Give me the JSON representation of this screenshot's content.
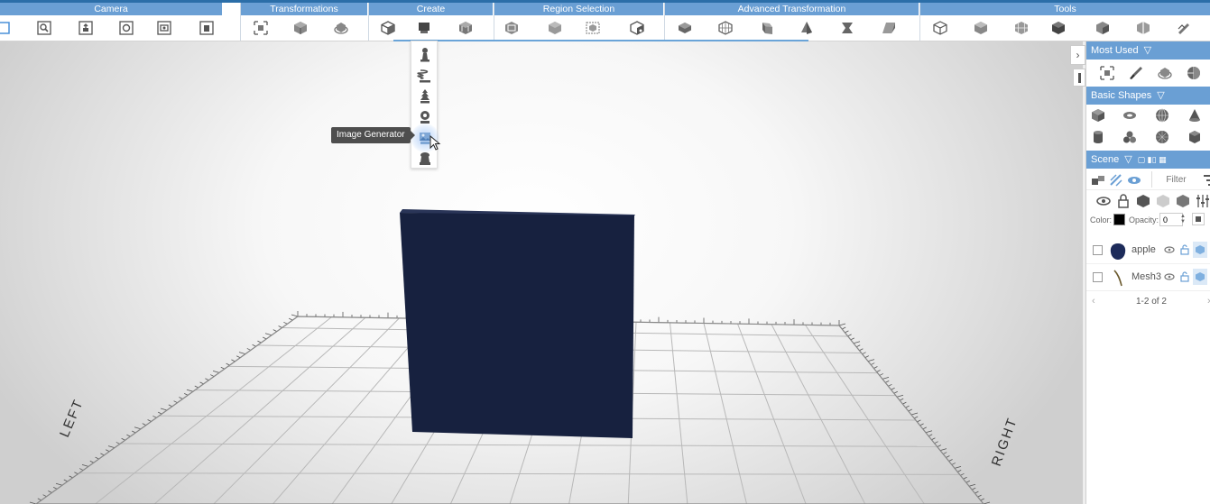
{
  "toolbar": {
    "groups": [
      {
        "label": "Camera"
      },
      {
        "label": "Transformations"
      },
      {
        "label": "Create"
      },
      {
        "label": "Region Selection"
      },
      {
        "label": "Advanced Transformation"
      },
      {
        "label": "Tools"
      }
    ]
  },
  "viewport": {
    "left_label": "LEFT",
    "right_label": "RIGHT",
    "box_color": "#17213f",
    "tooltip": "Image Generator"
  },
  "panel": {
    "most_used": "Most Used",
    "basic_shapes": "Basic Shapes",
    "scene": "Scene",
    "filter_placeholder": "Filter",
    "color_label": "Color:",
    "opacity_label": "Opacity:",
    "opacity_value": "0",
    "layers": [
      {
        "name": "apple"
      },
      {
        "name": "Mesh3"
      }
    ],
    "pager": "1-2 of 2",
    "accent": "#6a9fd4"
  }
}
